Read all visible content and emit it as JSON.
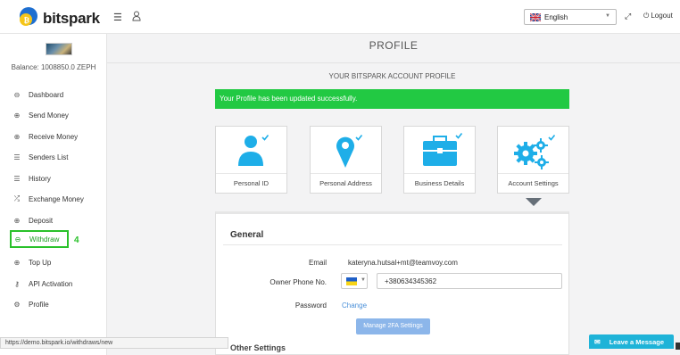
{
  "header": {
    "brand": "bitspark",
    "language": "English",
    "logout_label": "Logout"
  },
  "sidebar": {
    "balance": "Balance: 1008850.0 ZEPH",
    "items": [
      {
        "label": "Dashboard",
        "icon": "dashboard-icon"
      },
      {
        "label": "Send Money",
        "icon": "send-money-icon"
      },
      {
        "label": "Receive Money",
        "icon": "receive-money-icon"
      },
      {
        "label": "Senders List",
        "icon": "list-icon"
      },
      {
        "label": "History",
        "icon": "history-icon"
      },
      {
        "label": "Exchange Money",
        "icon": "exchange-icon"
      },
      {
        "label": "Deposit",
        "icon": "deposit-icon"
      },
      {
        "label": "Withdraw",
        "icon": "withdraw-icon"
      },
      {
        "label": "Top Up",
        "icon": "top-up-icon"
      },
      {
        "label": "API Activation",
        "icon": "key-icon"
      },
      {
        "label": "Profile",
        "icon": "gear-icon"
      }
    ],
    "step_marker": "4"
  },
  "main": {
    "title": "PROFILE",
    "subtitle": "YOUR BITSPARK ACCOUNT PROFILE",
    "alert": "Your Profile has been updated successfully.",
    "cards": [
      {
        "label": "Personal ID"
      },
      {
        "label": "Personal Address"
      },
      {
        "label": "Business Details"
      },
      {
        "label": "Account Settings"
      }
    ],
    "panel": {
      "heading": "General",
      "email_label": "Email",
      "email_value": "kateryna.hutsal+mt@teamvoy.com",
      "phone_label": "Owner Phone No.",
      "phone_value": "+380634345362",
      "password_label": "Password",
      "change_label": "Change",
      "twofa_button": "Manage 2FA Settings",
      "other_heading": "Other Settings"
    }
  },
  "footer": {
    "status_url": "https://demo.bitspark.io/withdraws/new",
    "leave_message": "Leave a Message"
  },
  "colors": {
    "accent_blue": "#1eaee8",
    "success_green": "#22c943",
    "highlight_green": "#29c12a"
  }
}
